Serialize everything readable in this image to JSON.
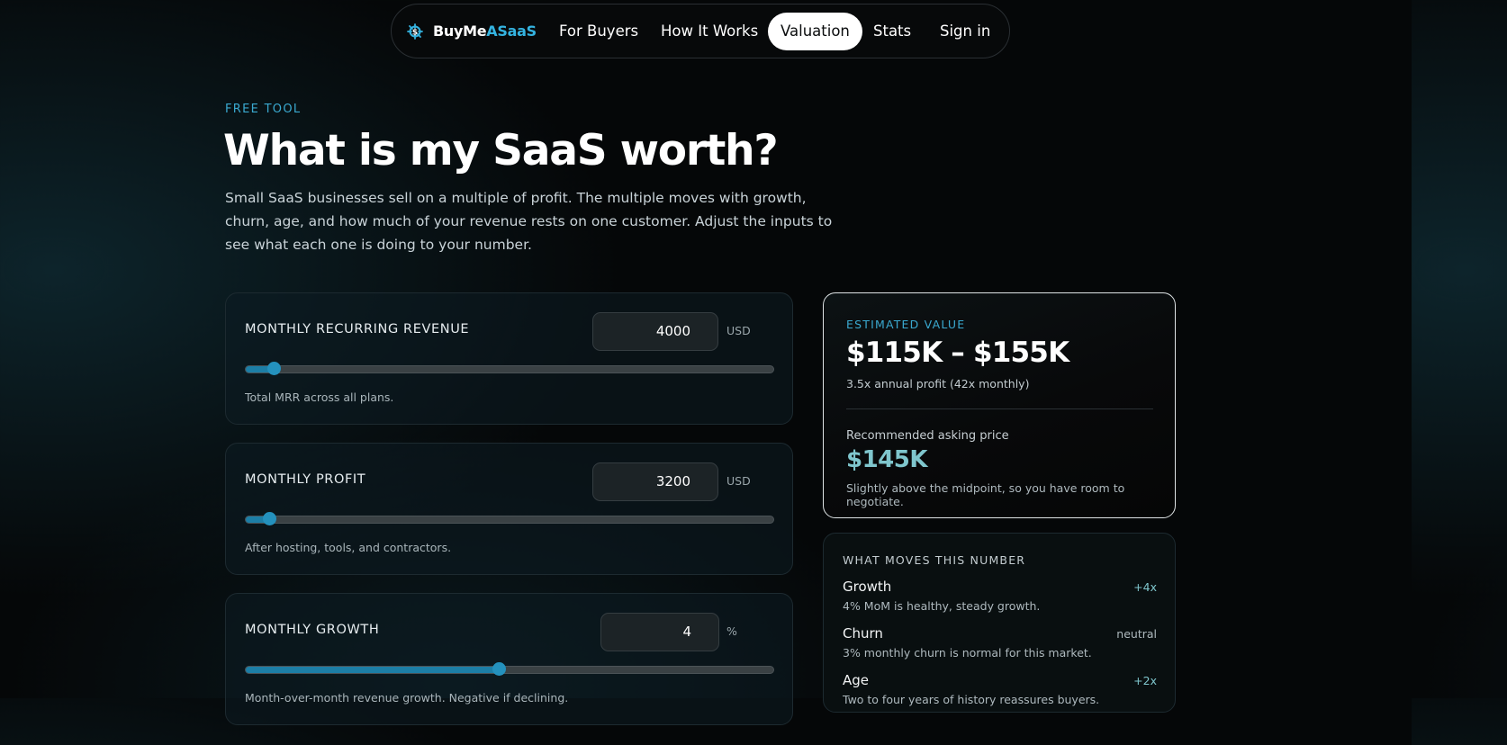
{
  "nav": {
    "brand": {
      "part1": "BuyMe",
      "part2": "ASaaS",
      "icon": "brand-logo-icon"
    },
    "links": [
      {
        "label": "For Buyers",
        "active": false
      },
      {
        "label": "How It Works",
        "active": false
      },
      {
        "label": "Valuation",
        "active": true
      },
      {
        "label": "Stats",
        "active": false
      },
      {
        "label": "Sign in",
        "active": false
      }
    ]
  },
  "hero": {
    "eyebrow": "FREE TOOL",
    "title": "What is my SaaS worth?",
    "description": "Small SaaS businesses sell on a multiple of profit. The multiple moves with growth, churn, age, and how much of your revenue rests on one customer. Adjust the inputs to see what each one is doing to your number."
  },
  "inputs": [
    {
      "label": "MONTHLY RECURRING REVENUE",
      "value": "4000",
      "unit": "USD",
      "slider_fraction": 0.053,
      "help": "Total MRR across all plans."
    },
    {
      "label": "MONTHLY PROFIT",
      "value": "3200",
      "unit": "USD",
      "slider_fraction": 0.044,
      "help": "After hosting, tools, and contractors."
    },
    {
      "label": "MONTHLY GROWTH",
      "value": "4",
      "unit": "%",
      "slider_fraction": 0.48,
      "help": "Month-over-month revenue growth. Negative if declining."
    }
  ],
  "estimate": {
    "eyebrow": "ESTIMATED VALUE",
    "range": "$115K – $155K",
    "multiple": "3.5x annual profit (42x monthly)",
    "ask_label": "Recommended asking price",
    "ask_price": "$145K",
    "ask_note": "Slightly above the midpoint, so you have room to negotiate."
  },
  "factors": {
    "title": "WHAT MOVES THIS NUMBER",
    "items": [
      {
        "name": "Growth",
        "note": "4% MoM is healthy, steady growth.",
        "effect": "+4x",
        "tone": "positive"
      },
      {
        "name": "Churn",
        "note": "3% monthly churn is normal for this market.",
        "effect": "neutral",
        "tone": "neutral"
      },
      {
        "name": "Age",
        "note": "Two to four years of history reassures buyers.",
        "effect": "+2x",
        "tone": "positive"
      }
    ]
  },
  "colors": {
    "accent": "#3aa9d0",
    "slider": "#1c7ea6",
    "price": "#7fc6cd"
  }
}
